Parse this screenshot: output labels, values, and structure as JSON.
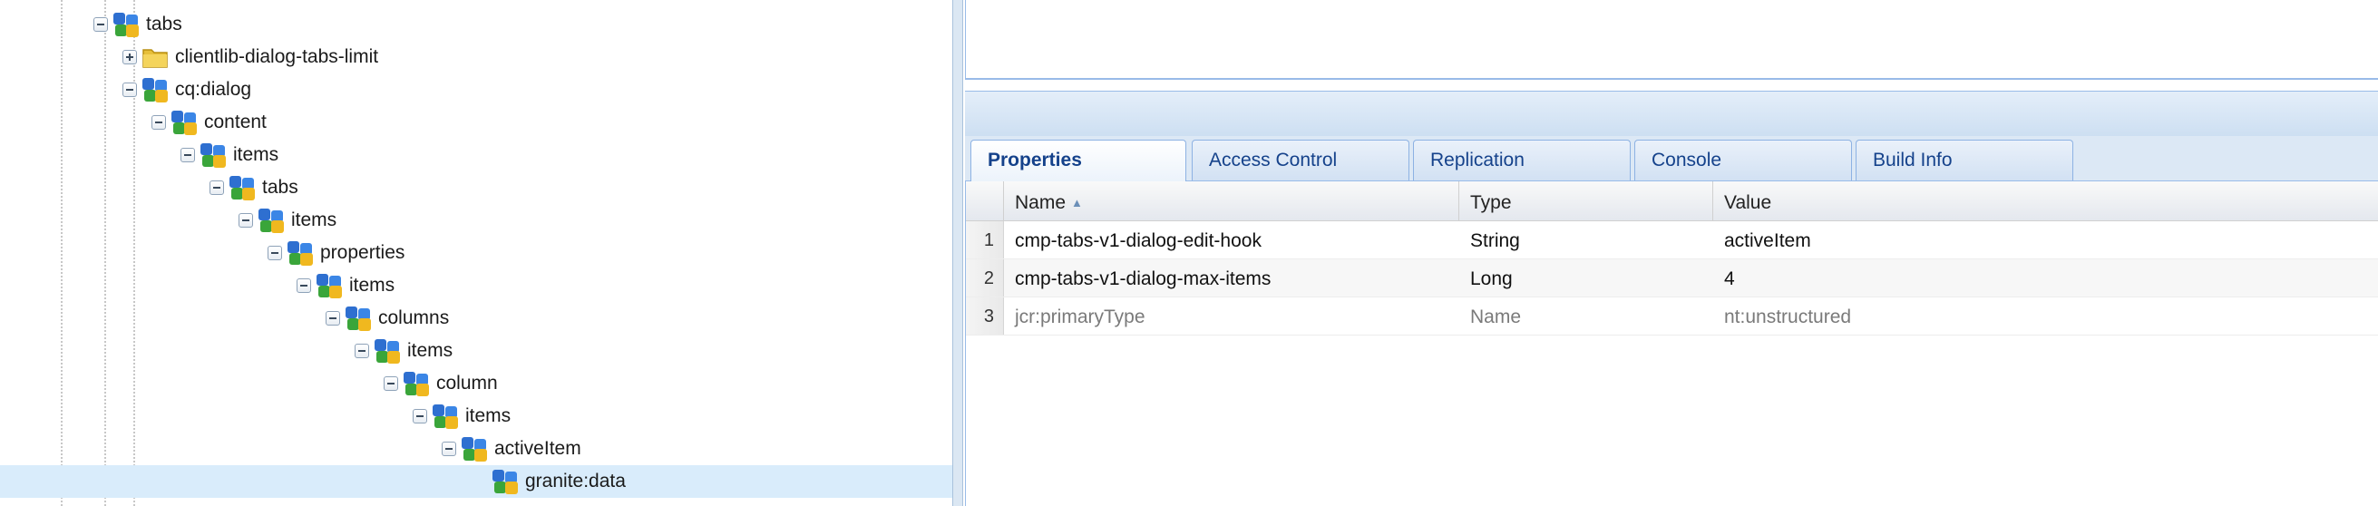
{
  "tree": {
    "nodes": [
      {
        "label": "tabs",
        "expander": "minus",
        "icon": "node-icon"
      },
      {
        "label": "clientlib-dialog-tabs-limit",
        "expander": "plus",
        "icon": "folder-icon"
      },
      {
        "label": "cq:dialog",
        "expander": "minus",
        "icon": "node-icon"
      },
      {
        "label": "content",
        "expander": "minus",
        "icon": "node-icon"
      },
      {
        "label": "items",
        "expander": "minus",
        "icon": "node-icon"
      },
      {
        "label": "tabs",
        "expander": "minus",
        "icon": "node-icon"
      },
      {
        "label": "items",
        "expander": "minus",
        "icon": "node-icon"
      },
      {
        "label": "properties",
        "expander": "minus",
        "icon": "node-icon"
      },
      {
        "label": "items",
        "expander": "minus",
        "icon": "node-icon"
      },
      {
        "label": "columns",
        "expander": "minus",
        "icon": "node-icon"
      },
      {
        "label": "items",
        "expander": "minus",
        "icon": "node-icon"
      },
      {
        "label": "column",
        "expander": "minus",
        "icon": "node-icon"
      },
      {
        "label": "items",
        "expander": "minus",
        "icon": "node-icon"
      },
      {
        "label": "activeItem",
        "expander": "minus",
        "icon": "node-icon"
      },
      {
        "label": "granite:data",
        "expander": "none",
        "icon": "node-icon",
        "selected": true
      }
    ]
  },
  "tabs": [
    {
      "label": "Properties",
      "active": true
    },
    {
      "label": "Access Control",
      "active": false
    },
    {
      "label": "Replication",
      "active": false
    },
    {
      "label": "Console",
      "active": false
    },
    {
      "label": "Build Info",
      "active": false
    }
  ],
  "grid": {
    "columns": {
      "name": "Name",
      "type": "Type",
      "value": "Value"
    },
    "rows": [
      {
        "num": "1",
        "name": "cmp-tabs-v1-dialog-edit-hook",
        "type": "String",
        "value": "activeItem",
        "muted": false
      },
      {
        "num": "2",
        "name": "cmp-tabs-v1-dialog-max-items",
        "type": "Long",
        "value": "4",
        "muted": false
      },
      {
        "num": "3",
        "name": "jcr:primaryType",
        "type": "Name",
        "value": "nt:unstructured",
        "muted": true
      }
    ]
  },
  "colors": {
    "accent": "#15428b",
    "selected_row": "#d9ecfb",
    "panel_border": "#99bbe8"
  }
}
